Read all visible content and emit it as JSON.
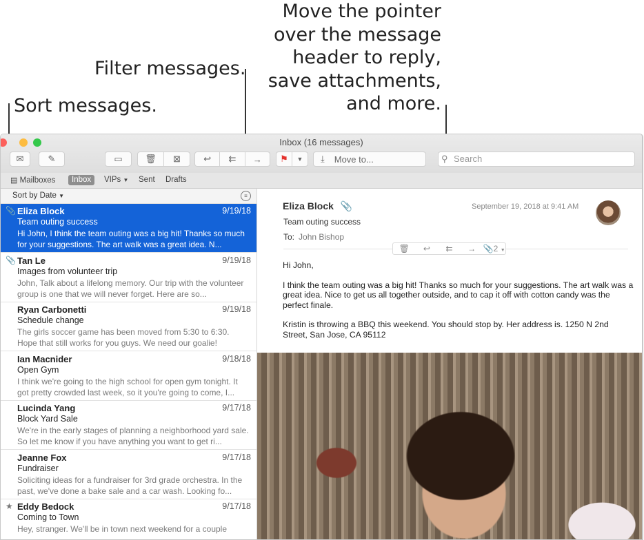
{
  "callouts": {
    "sort": "Sort messages.",
    "filter": "Filter messages.",
    "pointer_line1": "Move the pointer",
    "pointer_line2": "over the message",
    "pointer_line3": "header to reply,",
    "pointer_line4": "save attachments,",
    "pointer_line5": "and more."
  },
  "window": {
    "title": "Inbox (16 messages)"
  },
  "toolbar": {
    "move_to_label": "Move to...",
    "search_placeholder": "Search",
    "icons": [
      "get-mail-icon",
      "compose-icon",
      "archive-icon",
      "trash-icon",
      "junk-icon",
      "reply-icon",
      "reply-all-icon",
      "forward-icon",
      "flag-icon",
      "chevron-down-icon",
      "move-to-icon",
      "search-icon"
    ]
  },
  "favorites": {
    "mailboxes": "Mailboxes",
    "inbox": "Inbox",
    "vips": "VIPs",
    "sent": "Sent",
    "drafts": "Drafts"
  },
  "list": {
    "sort_label": "Sort by Date",
    "messages": [
      {
        "from": "Eliza Block",
        "date": "9/19/18",
        "subject": "Team outing success",
        "preview": "Hi John, I think the team outing was a big hit! Thanks so much for your suggestions. The art walk was a great idea. N...",
        "marker": "paperclip-icon",
        "selected": true
      },
      {
        "from": "Tan Le",
        "date": "9/19/18",
        "subject": "Images from volunteer trip",
        "preview": "John, Talk about a lifelong memory. Our trip with the volunteer group is one that we will never forget. Here are so...",
        "marker": "paperclip-icon",
        "selected": false
      },
      {
        "from": "Ryan Carbonetti",
        "date": "9/19/18",
        "subject": "Schedule change",
        "preview": "The girls soccer game has been moved from 5:30 to 6:30. Hope that still works for you guys. We need our goalie!",
        "marker": "",
        "selected": false
      },
      {
        "from": "Ian Macnider",
        "date": "9/18/18",
        "subject": "Open Gym",
        "preview": "I think we're going to the high school for open gym tonight. It got pretty crowded last week, so it you're going to come, I...",
        "marker": "",
        "selected": false
      },
      {
        "from": "Lucinda Yang",
        "date": "9/17/18",
        "subject": "Block Yard Sale",
        "preview": "We're in the early stages of planning a neighborhood yard sale. So let me know if you have anything you want to get ri...",
        "marker": "",
        "selected": false
      },
      {
        "from": "Jeanne Fox",
        "date": "9/17/18",
        "subject": "Fundraiser",
        "preview": "Soliciting ideas for a fundraiser for 3rd grade orchestra. In the past, we've done a bake sale and a car wash. Looking fo...",
        "marker": "",
        "selected": false
      },
      {
        "from": "Eddy Bedock",
        "date": "9/17/18",
        "subject": "Coming to Town",
        "preview": "Hey, stranger. We'll be in town next weekend for a couple",
        "marker": "star-icon",
        "selected": false
      }
    ]
  },
  "reader": {
    "from": "Eliza Block",
    "date": "September 19, 2018 at 9:41 AM",
    "subject": "Team outing success",
    "to_label": "To:",
    "to_value": "John Bishop",
    "attachment_count": "2",
    "greeting": "Hi John,",
    "para1": "I think the team outing was a big hit! Thanks so much for your suggestions. The art walk was a great idea. Nice to get us all together outside, and to cap it off with cotton candy was the perfect finale.",
    "para2": "Kristin is throwing a BBQ this weekend. You should stop by. Her address is. 1250 N 2nd Street, San Jose, CA 95112"
  },
  "colors": {
    "selection": "#1463d8",
    "close": "#fc605c",
    "minimize": "#fdbc40",
    "zoom": "#34c84a",
    "flag": "#e5322d"
  }
}
